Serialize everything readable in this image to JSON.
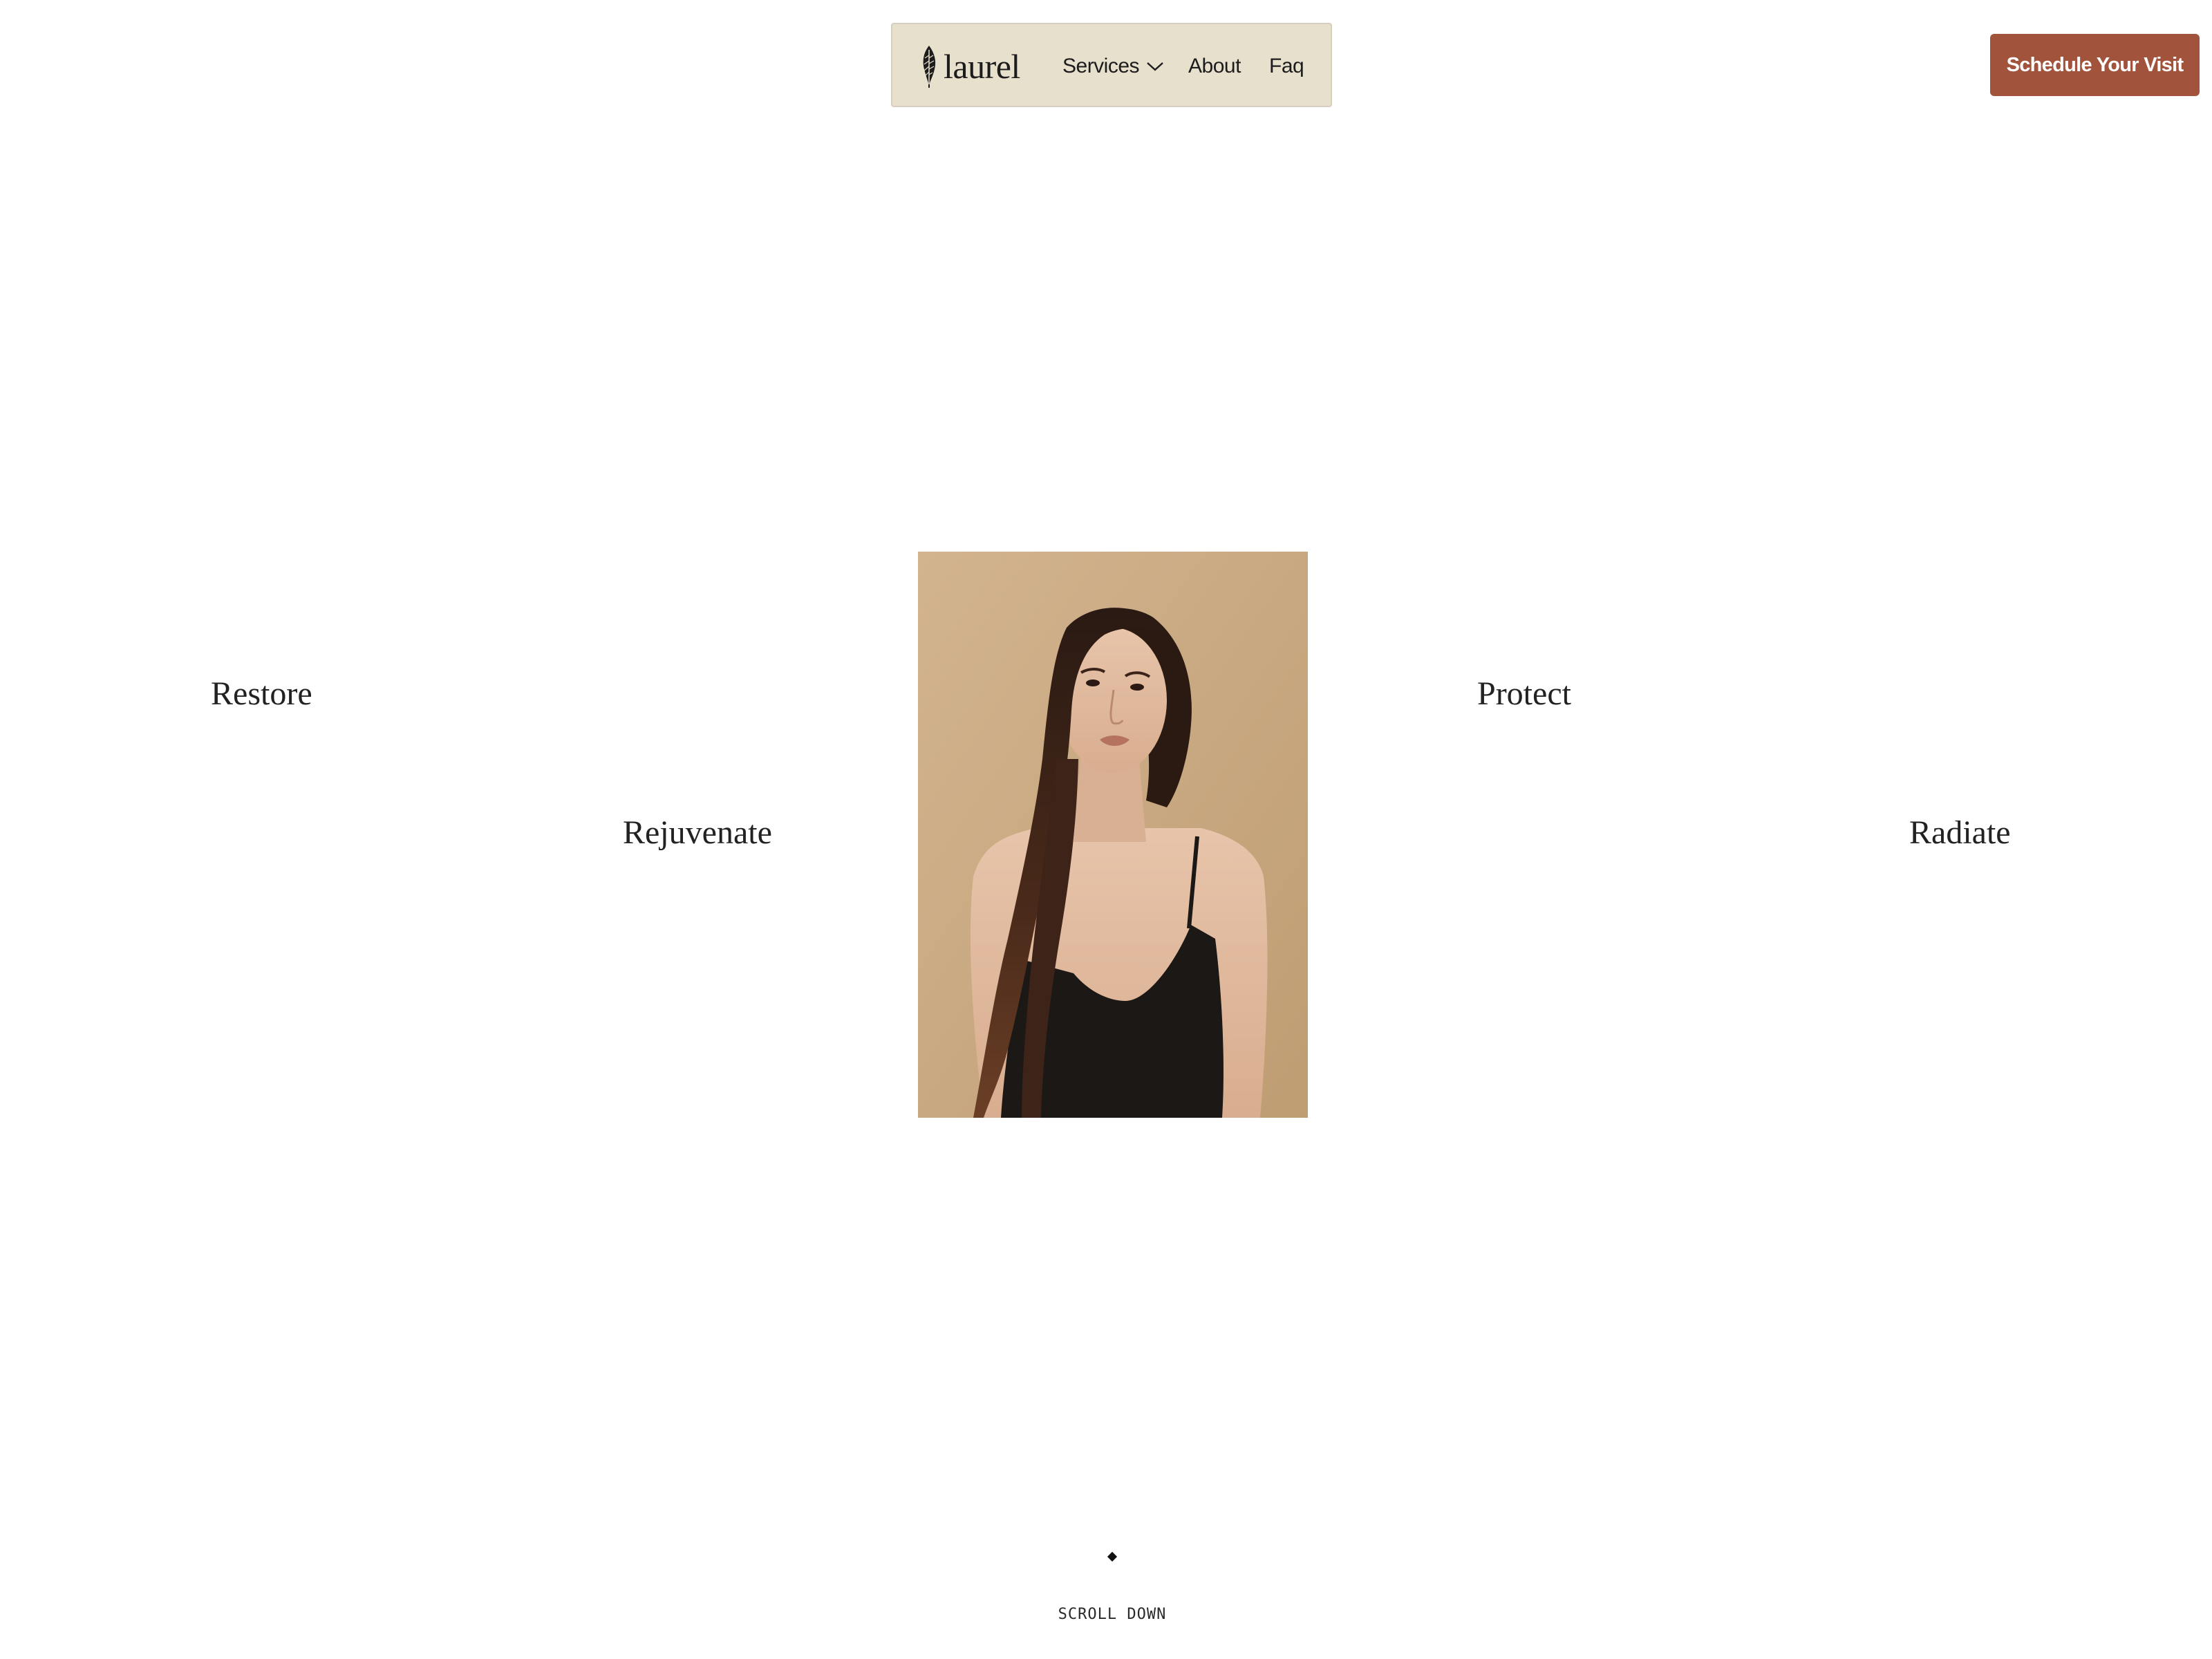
{
  "brand": {
    "logo_text": "laurel",
    "logo_icon": "leaf-icon"
  },
  "nav": {
    "services_label": "Services",
    "about_label": "About",
    "faq_label": "Faq",
    "services_icon": "chevron-down-icon"
  },
  "cta": {
    "label": "Schedule Your Visit",
    "color": "#a2533b"
  },
  "hero": {
    "words": {
      "restore": "Restore",
      "rejuvenate": "Rejuvenate",
      "protect": "Protect",
      "radiate": "Radiate"
    },
    "image_alt": "Portrait of a woman with long dark hair in a black camisole against a tan background"
  },
  "scroll": {
    "label": "SCROLL DOWN"
  },
  "colors": {
    "nav_bg": "#e7e0cd",
    "photo_bg": "#c9a982"
  }
}
